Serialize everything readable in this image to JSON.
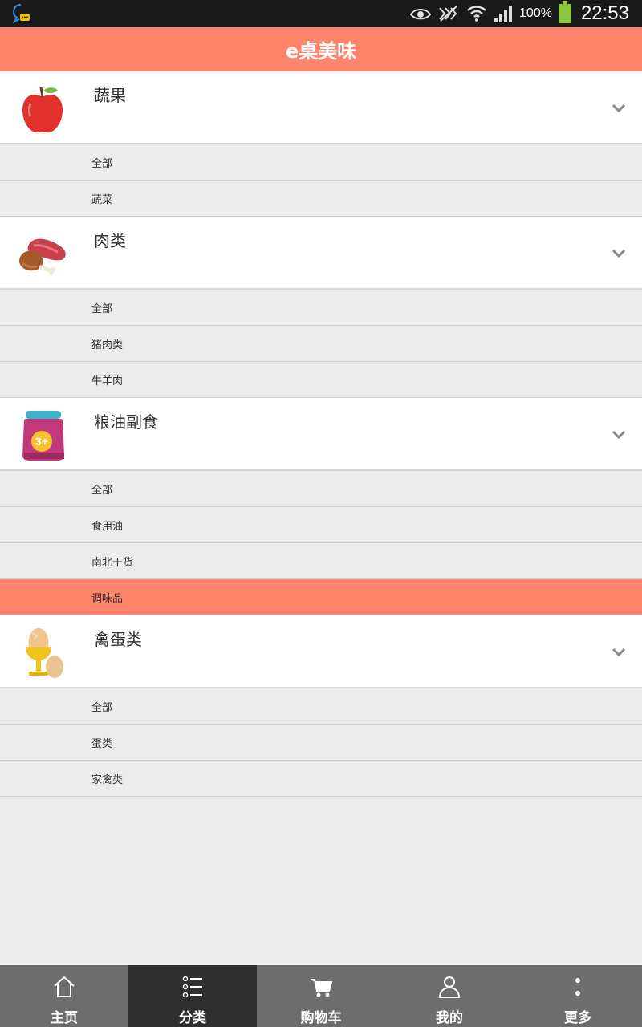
{
  "status_bar": {
    "battery_text": "100%",
    "time": "22:53",
    "icons": [
      "qq-chat-icon",
      "eye-icon",
      "nfc-icon",
      "wifi-icon",
      "signal-icon",
      "battery-icon"
    ]
  },
  "header": {
    "title": "e桌美味"
  },
  "categories": [
    {
      "label": "蔬果",
      "icon": "apple-icon",
      "subs": [
        {
          "label": "全部"
        },
        {
          "label": "蔬菜"
        }
      ]
    },
    {
      "label": "肉类",
      "icon": "meat-icon",
      "subs": [
        {
          "label": "全部"
        },
        {
          "label": "猪肉类"
        },
        {
          "label": "牛羊肉"
        }
      ]
    },
    {
      "label": "粮油副食",
      "icon": "jar-icon",
      "subs": [
        {
          "label": "全部"
        },
        {
          "label": "食用油"
        },
        {
          "label": "南北干货"
        },
        {
          "label": "调味品",
          "active": true
        }
      ]
    },
    {
      "label": "禽蛋类",
      "icon": "egg-icon",
      "subs": [
        {
          "label": "全部"
        },
        {
          "label": "蛋类"
        },
        {
          "label": "家禽类"
        }
      ]
    }
  ],
  "nav": [
    {
      "label": "主页",
      "icon": "home-icon"
    },
    {
      "label": "分类",
      "icon": "list-icon",
      "active": true
    },
    {
      "label": "购物车",
      "icon": "cart-icon"
    },
    {
      "label": "我的",
      "icon": "user-icon"
    },
    {
      "label": "更多",
      "icon": "more-icon"
    }
  ],
  "colors": {
    "accent": "#ff846c",
    "nav_bg": "#6d6d6d",
    "nav_active": "#2f2f2f",
    "status_bar": "#1a1a1a"
  }
}
